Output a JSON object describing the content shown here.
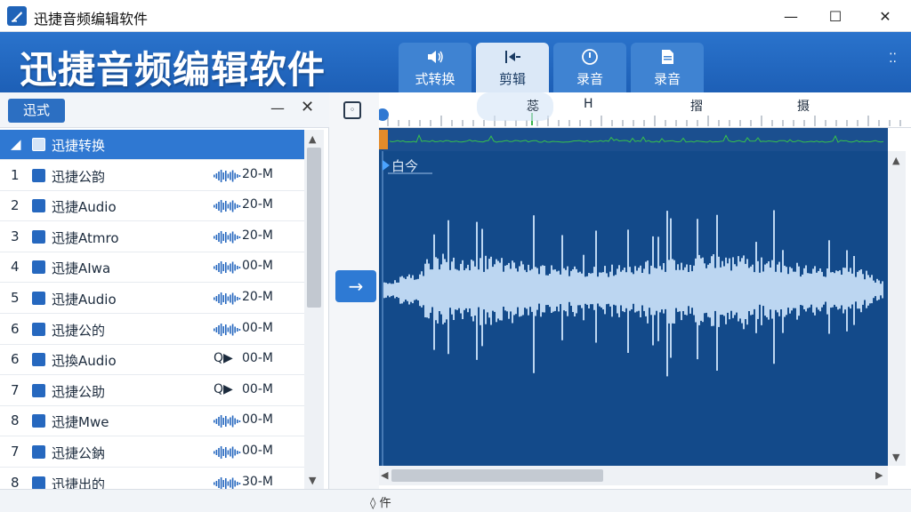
{
  "window": {
    "title": "迅捷音频编辑软件",
    "minimize": "—",
    "maximize": "☐",
    "close": "✕"
  },
  "banner": {
    "brand": "迅捷音频编辑软件",
    "tabs": [
      {
        "label": "式转换",
        "icon": "speaker-icon",
        "active": false
      },
      {
        "label": "剪辑",
        "icon": "scissors-icon",
        "active": true
      },
      {
        "label": "录音",
        "icon": "record-icon",
        "active": false
      },
      {
        "label": "录音",
        "icon": "document-icon",
        "active": false
      }
    ],
    "more": "⁚⁚"
  },
  "left_panel": {
    "button": "迅式",
    "minimize": "—",
    "close": "✕",
    "rows": [
      {
        "num": "◢",
        "name": "迅捷转换",
        "play": "",
        "size": "",
        "selected": true
      },
      {
        "num": "1",
        "name": "迅捷公韵",
        "play": "",
        "size": "20-M"
      },
      {
        "num": "2",
        "name": "迅捷Audio",
        "play": "",
        "size": "20-M"
      },
      {
        "num": "3",
        "name": "迅捷Atmro",
        "play": "",
        "size": "20-M"
      },
      {
        "num": "4",
        "name": "迅捷AIwa",
        "play": "",
        "size": "00-M"
      },
      {
        "num": "5",
        "name": "迅捷Audio",
        "play": "",
        "size": "20-M"
      },
      {
        "num": "6",
        "name": "迅捷公的",
        "play": "",
        "size": "00-M"
      },
      {
        "num": "6",
        "name": "迅換Audio",
        "play": "Q▶",
        "size": "00-M"
      },
      {
        "num": "7",
        "name": "迅捷公助",
        "play": "Q▶",
        "size": "00-M"
      },
      {
        "num": "8",
        "name": "迅捷Mwe",
        "play": "",
        "size": "00-M"
      },
      {
        "num": "7",
        "name": "迅捷公鈉",
        "play": "",
        "size": "00-M"
      },
      {
        "num": "8",
        "name": "迅捷出的",
        "play": "",
        "size": "30-M"
      }
    ]
  },
  "middle": {
    "arrow": "→"
  },
  "timeline": {
    "labels": [
      "蕊",
      "ᕼ",
      "摺",
      "摄"
    ]
  },
  "editor": {
    "marker_label": "白今",
    "wave_color": "#bcd6f1",
    "background": "#134a8a"
  },
  "statusbar": {
    "text": "◊ 仵"
  },
  "colors": {
    "accent": "#2f78d2",
    "banner": "#1d5fb6",
    "overview_wave": "#37c24a"
  }
}
